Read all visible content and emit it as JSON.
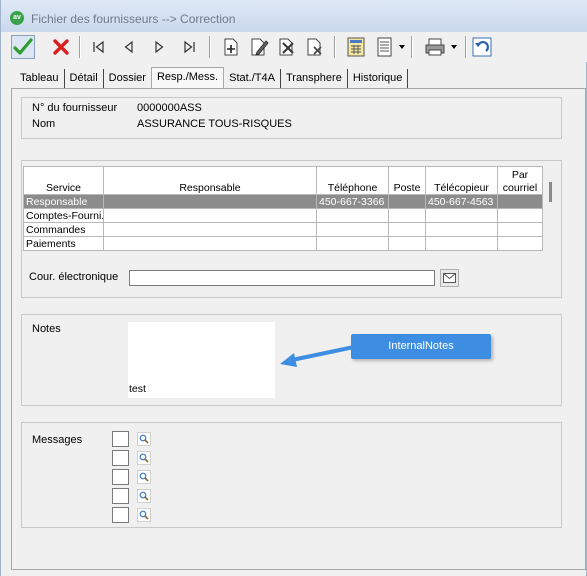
{
  "window": {
    "title": "Fichier des fournisseurs --> Correction",
    "app_icon_text": "av"
  },
  "toolbar": {
    "buttons": [
      {
        "name": "confirm-icon"
      },
      {
        "name": "cancel-icon"
      },
      {
        "name": "first-record-icon"
      },
      {
        "name": "previous-record-icon"
      },
      {
        "name": "next-record-icon"
      },
      {
        "name": "last-record-icon"
      },
      {
        "name": "new-document-icon"
      },
      {
        "name": "edit-document-icon"
      },
      {
        "name": "tools-document-icon"
      },
      {
        "name": "delete-document-icon"
      },
      {
        "name": "calculator-icon"
      },
      {
        "name": "report-icon"
      },
      {
        "name": "print-icon"
      },
      {
        "name": "undo-icon"
      }
    ]
  },
  "tabs": [
    {
      "label": "Tableau",
      "active": false
    },
    {
      "label": "Détail",
      "active": false
    },
    {
      "label": "Dossier",
      "active": false
    },
    {
      "label": "Resp./Mess.",
      "active": true
    },
    {
      "label": "Stat./T4A",
      "active": false
    },
    {
      "label": "Transphere",
      "active": false
    },
    {
      "label": "Historique",
      "active": false
    }
  ],
  "supplier": {
    "number_label": "N° du fournisseur",
    "number_value": "0000000ASS",
    "name_label": "Nom",
    "name_value": "ASSURANCE TOUS-RISQUES"
  },
  "contacts": {
    "headers": {
      "service": "Service",
      "responsable": "Responsable",
      "telephone": "Téléphone",
      "poste": "Poste",
      "telecopieur": "Télécopieur",
      "par_courriel_1": "Par",
      "par_courriel_2": "courriel"
    },
    "rows": [
      {
        "service": "Responsable",
        "responsable": "",
        "telephone": "450-667-3366",
        "poste": "",
        "telecopieur": "450-667-4563",
        "courriel": "",
        "selected": true
      },
      {
        "service": "Comptes-Fourni.",
        "responsable": "",
        "telephone": "",
        "poste": "",
        "telecopieur": "",
        "courriel": "",
        "selected": false
      },
      {
        "service": "Commandes",
        "responsable": "",
        "telephone": "",
        "poste": "",
        "telecopieur": "",
        "courriel": "",
        "selected": false
      },
      {
        "service": "Paiements",
        "responsable": "",
        "telephone": "",
        "poste": "",
        "telecopieur": "",
        "courriel": "",
        "selected": false
      }
    ]
  },
  "email": {
    "label": "Cour. électronique",
    "value": ""
  },
  "notes": {
    "label": "Notes",
    "value": "test",
    "callout": "InternalNotes",
    "callout_color": "#3d8ee2"
  },
  "messages": {
    "label": "Messages",
    "items": [
      {
        "checked": false
      },
      {
        "checked": false
      },
      {
        "checked": false
      },
      {
        "checked": false
      },
      {
        "checked": false
      }
    ]
  },
  "colors": {
    "selected_row": "#8c8c8c",
    "confirm": "#2e9e2e",
    "cancel": "#d92020"
  }
}
